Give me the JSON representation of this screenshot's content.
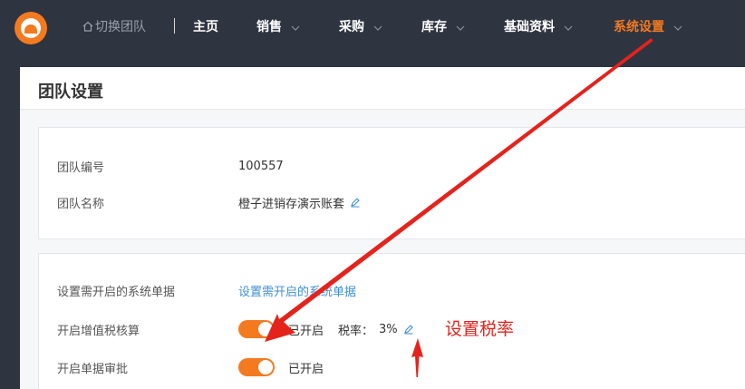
{
  "header": {
    "switch_team_label": "切换团队",
    "nav": [
      {
        "label": "主页",
        "has_dropdown": false
      },
      {
        "label": "销售",
        "has_dropdown": true
      },
      {
        "label": "采购",
        "has_dropdown": true
      },
      {
        "label": "库存",
        "has_dropdown": true
      },
      {
        "label": "基础资料",
        "has_dropdown": true
      },
      {
        "label": "系统设置",
        "has_dropdown": true,
        "active": true
      }
    ]
  },
  "page": {
    "title": "团队设置"
  },
  "team_info": {
    "id_label": "团队编号",
    "id_value": "100557",
    "name_label": "团队名称",
    "name_value": "橙子进销存演示账套"
  },
  "settings": {
    "docs_label": "设置需开启的系统单据",
    "docs_link": "设置需开启的系统单据",
    "vat_label": "开启增值税核算",
    "vat_state": "已开启",
    "vat_enabled": true,
    "tax_rate_label": "税率：",
    "tax_rate_value": "3%",
    "approval_label": "开启单据审批",
    "approval_state": "已开启",
    "approval_enabled": true
  },
  "annotation": {
    "text": "设置税率",
    "color": "#e4231c"
  },
  "colors": {
    "accent": "#f47a20",
    "topbar": "#2f3441",
    "link": "#3d8fd8"
  }
}
